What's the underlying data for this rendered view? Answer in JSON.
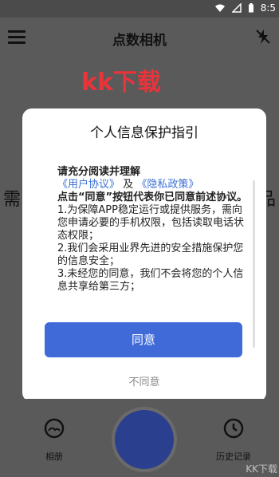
{
  "statusbar": {
    "time": "8:5"
  },
  "appbar": {
    "title": "点数相机"
  },
  "watermark_top": "kk下载",
  "side_text": {
    "left": "需",
    "right": "品"
  },
  "dialog": {
    "title": "个人信息保护指引",
    "lead": "请充分阅读并理解",
    "user_agreement": "《用户协议》",
    "and": "及",
    "privacy_policy": "《隐私政策》",
    "consent_line": "点击“同意”按钮代表你已同意前述协议。",
    "item1": "1.为保障APP稳定运行或提供服务，需向您申请必要的手机权限，包括读取电话状态权限；",
    "item2": "2.我们会采用业界先进的安全措施保护您的信息安全；",
    "item3": "3.未经您的同意，我们不会将您的个人信息共享给第三方；",
    "agree": "同意",
    "disagree": "不同意"
  },
  "bottom": {
    "album_label": "相册",
    "history_label": "历史记录"
  },
  "watermark_corner": "KK下载"
}
